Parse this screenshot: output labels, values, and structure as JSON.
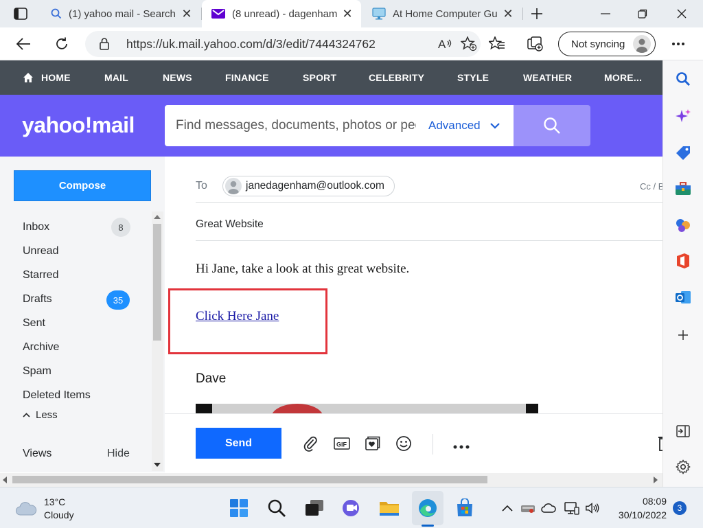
{
  "browser": {
    "tabs": [
      {
        "title": "(1) yahoo mail - Search",
        "active": false
      },
      {
        "title": "(8 unread) - dagenham",
        "active": true
      },
      {
        "title": "At Home Computer Gu",
        "active": false
      }
    ],
    "url": "https://uk.mail.yahoo.com/d/3/edit/7444324762",
    "sync_label": "Not syncing"
  },
  "yahoo_nav": {
    "items": [
      "HOME",
      "MAIL",
      "NEWS",
      "FINANCE",
      "SPORT",
      "CELEBRITY",
      "STYLE",
      "WEATHER",
      "MORE..."
    ]
  },
  "header": {
    "logo": "yahoo!mail",
    "search_placeholder": "Find messages, documents, photos or peo",
    "advanced_label": "Advanced"
  },
  "sidebar": {
    "compose_label": "Compose",
    "folders": [
      {
        "label": "Inbox",
        "count": "8"
      },
      {
        "label": "Unread"
      },
      {
        "label": "Starred"
      },
      {
        "label": "Drafts",
        "count": "35"
      },
      {
        "label": "Sent"
      },
      {
        "label": "Archive"
      },
      {
        "label": "Spam"
      },
      {
        "label": "Deleted Items"
      }
    ],
    "less_label": "Less",
    "views_label": "Views",
    "hide_label": "Hide"
  },
  "compose": {
    "to_label": "To",
    "recipient": "janedagenham@outlook.com",
    "cc_label": "Cc / B",
    "subject": "Great Website",
    "body_text": "Hi Jane, take a look at this great website.",
    "link_text": "Click Here Jane",
    "signature": "Dave",
    "send_label": "Send",
    "gif_label": "GIF"
  },
  "taskbar": {
    "temperature": "13°C",
    "condition": "Cloudy",
    "time": "08:09",
    "date": "30/10/2022",
    "notifications": "3"
  },
  "colors": {
    "yahoo_purple": "#6a5cf7",
    "nav_dark": "#464e56",
    "compose_blue": "#1e90ff",
    "send_blue": "#0f69ff",
    "highlight_red": "#e2343c"
  }
}
